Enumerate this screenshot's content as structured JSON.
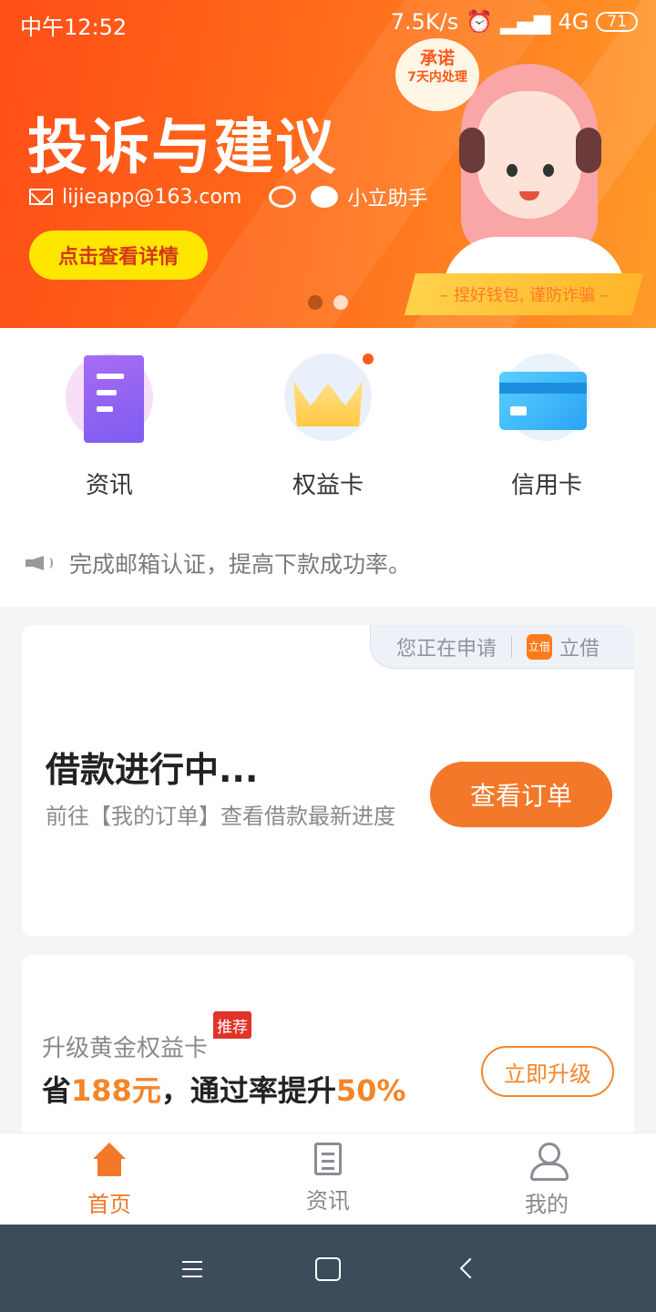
{
  "status_bar": {
    "time": "中午12:52",
    "net_speed": "7.5K/s",
    "network": "4G",
    "battery": "71"
  },
  "banner": {
    "title": "投诉与建议",
    "email": "lijieapp@163.com",
    "wechat": "小立助手",
    "button": "点击查看详情",
    "promise_line1": "承诺",
    "promise_line2": "7天内处理",
    "slogan": "– 捏好钱包, 谨防诈骗 –"
  },
  "quick_links": [
    {
      "label": "资讯",
      "icon": "document-icon"
    },
    {
      "label": "权益卡",
      "icon": "crown-icon"
    },
    {
      "label": "信用卡",
      "icon": "credit-card-icon"
    }
  ],
  "notice": "完成邮箱认证，提高下款成功率。",
  "loan_card": {
    "applying_label": "您正在申请",
    "app_logo_text": "立借",
    "app_name": "立借",
    "title": "借款进行中...",
    "subtitle": "前往【我的订单】查看借款最新进度",
    "button": "查看订单"
  },
  "upgrade_card": {
    "title": "升级黄金权益卡",
    "badge": "推荐",
    "save_prefix": "省",
    "save_amount": "188元",
    "mid_text": "，通过率提升",
    "rate": "50%",
    "button": "立即升级"
  },
  "tabbar": {
    "home": "首页",
    "news": "资讯",
    "mine": "我的"
  },
  "colors": {
    "accent": "#f3782a",
    "banner": "#ff5a1a",
    "badge": "#e0332a"
  }
}
